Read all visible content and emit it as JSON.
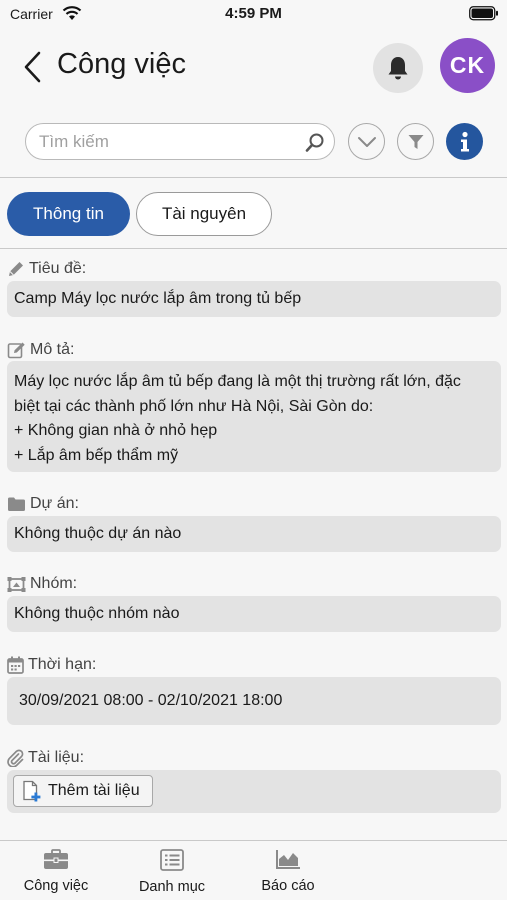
{
  "status_bar": {
    "carrier": "Carrier",
    "time": "4:59 PM"
  },
  "header": {
    "title": "Công việc",
    "avatar_initials": "CK",
    "avatar_color": "#8a4fc7",
    "search_placeholder": "Tìm kiếm",
    "icons": [
      "back-icon",
      "bell-icon",
      "search-icon",
      "chevron-down-icon",
      "filter-icon",
      "info-icon"
    ]
  },
  "tabs": {
    "active": "Thông tin",
    "inactive": "Tài nguyên",
    "accent": "#2a5ca8"
  },
  "fields": {
    "title": {
      "label": "Tiêu đề:",
      "value": "Camp Máy lọc nước lắp âm trong tủ bếp",
      "icon": "pencil-icon"
    },
    "description": {
      "label": "Mô tả:",
      "icon": "edit-icon",
      "lines": [
        "Máy lọc nước lắp âm tủ bếp đang là một thị trường rất lớn, đặc",
        "biệt tại các thành phố lớn như Hà Nội, Sài Gòn do:",
        "+ Không gian nhà ở nhỏ hẹp",
        "+ Lắp âm bếp thẩm mỹ"
      ]
    },
    "project": {
      "label": "Dự án:",
      "value": "Không thuộc dự án nào",
      "icon": "folder-icon"
    },
    "group": {
      "label": "Nhóm:",
      "value": "Không thuộc nhóm nào",
      "icon": "group-icon"
    },
    "deadline": {
      "label": "Thời hạn:",
      "value": "30/09/2021 08:00 - 02/10/2021 18:00",
      "icon": "calendar-icon"
    },
    "documents": {
      "label": "Tài liệu:",
      "button": "Thêm tài liệu",
      "icon": "paperclip-icon"
    }
  },
  "tab_bar": [
    {
      "label": "Công việc",
      "icon": "briefcase-icon"
    },
    {
      "label": "Danh mục",
      "icon": "list-icon"
    },
    {
      "label": "Báo cáo",
      "icon": "chart-icon"
    }
  ]
}
